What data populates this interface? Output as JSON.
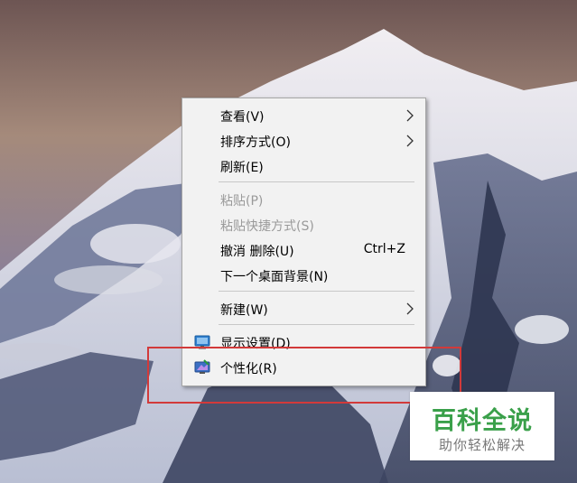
{
  "menu": {
    "items": [
      {
        "label": "查看(V)",
        "submenu": true,
        "enabled": true
      },
      {
        "label": "排序方式(O)",
        "submenu": true,
        "enabled": true
      },
      {
        "label": "刷新(E)",
        "enabled": true
      },
      {
        "label": "粘贴(P)",
        "enabled": false
      },
      {
        "label": "粘贴快捷方式(S)",
        "enabled": false
      },
      {
        "label": "撤消 删除(U)",
        "shortcut": "Ctrl+Z",
        "enabled": true
      },
      {
        "label": "下一个桌面背景(N)",
        "enabled": true
      },
      {
        "label": "新建(W)",
        "submenu": true,
        "enabled": true
      },
      {
        "label": "显示设置(D)",
        "icon": "display-icon",
        "enabled": true
      },
      {
        "label": "个性化(R)",
        "icon": "personalize-icon",
        "enabled": true
      }
    ]
  },
  "highlight": {
    "color": "#d23a3a"
  },
  "watermark": {
    "title": "百科全说",
    "subtitle": "助你轻松解决",
    "color": "#3aa04a"
  }
}
